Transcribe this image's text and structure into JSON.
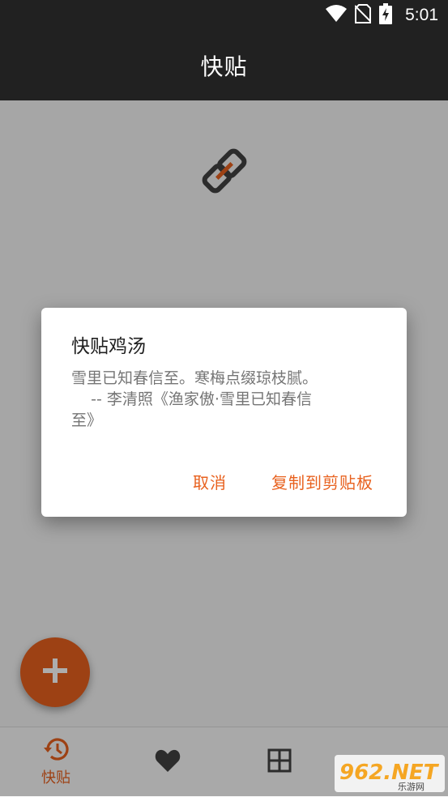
{
  "status_bar": {
    "time": "5:01"
  },
  "app_bar": {
    "title": "快贴"
  },
  "dialog": {
    "title": "快贴鸡汤",
    "body": "雪里已知春信至。寒梅点缀琼枝腻。\n    -- 李清照《渔家傲·雪里已知春信\n至》",
    "cancel_label": "取消",
    "copy_label": "复制到剪贴板"
  },
  "bottom_nav": {
    "items": [
      {
        "icon": "history-icon",
        "label": "快贴",
        "active": true
      },
      {
        "icon": "heart-icon",
        "label": "",
        "active": false
      },
      {
        "icon": "grid-icon",
        "label": "",
        "active": false
      }
    ]
  },
  "watermark": {
    "text": "962.NET",
    "subtext": "乐游网"
  },
  "colors": {
    "accent": "#e8611e",
    "app_bar": "#212121",
    "background": "#f5f5f5"
  }
}
